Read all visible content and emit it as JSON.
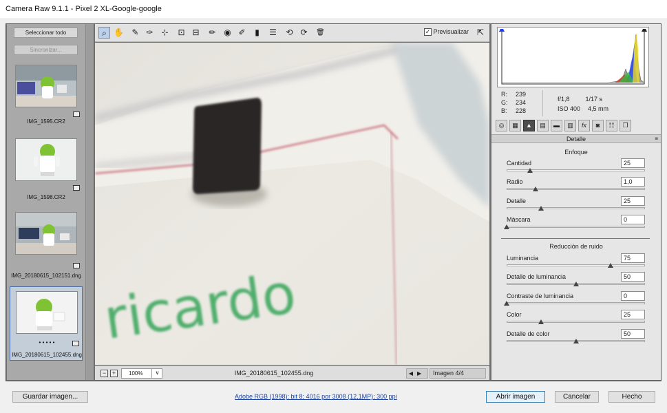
{
  "window": {
    "title": "Camera Raw 9.1.1 -  Pixel 2 XL-Google-google"
  },
  "filmstrip": {
    "select_all": "Seleccionar todo",
    "sync": "Sincronizar...",
    "thumbnails": [
      {
        "name": "IMG_1595.CR2"
      },
      {
        "name": "IMG_1598.CR2"
      },
      {
        "name": "IMG_20180615_102151.dng"
      },
      {
        "name": "IMG_20180615_102455.dng",
        "rating": "• • • • •"
      }
    ]
  },
  "toolbar": {
    "tools": [
      "zoom-icon",
      "hand-icon",
      "white-balance-icon",
      "color-sampler-icon",
      "targeted-adjustment-icon",
      "crop-icon",
      "straighten-icon",
      "spot-removal-icon",
      "red-eye-icon",
      "adjustment-brush-icon",
      "graduated-filter-icon",
      "radial-filter-icon",
      "preferences-icon",
      "rotate-left-icon",
      "rotate-right-icon",
      "trash-icon"
    ],
    "tool_glyphs": [
      "⌕",
      "✋",
      "✎",
      "✑",
      "⊹",
      "⊡",
      "⊟",
      "✏",
      "◉",
      "✐",
      "▮",
      "☰",
      "⟲",
      "⟳",
      "🗑"
    ],
    "preview_label": "Previsualizar",
    "preview_checked": "✓",
    "fullscreen_glyph": "⇱"
  },
  "preview": {
    "text": "ricardo"
  },
  "statusbar": {
    "zoom_minus": "−",
    "zoom_plus": "+",
    "zoom": "100%",
    "zoom_drop": "∨",
    "filename": "IMG_20180615_102455.dng",
    "nav": "◀▶",
    "image_count": "Imagen 4/4"
  },
  "readout": {
    "r_label": "R:",
    "r": "239",
    "g_label": "G:",
    "g": "234",
    "b_label": "B:",
    "b": "228",
    "aperture": "f/1,8",
    "shutter": "1/17 s",
    "iso": "ISO 400",
    "focal": "4,5 mm"
  },
  "panel_tabs": [
    "basic-tab",
    "tone-curve-tab",
    "detail-tab",
    "hsl-tab",
    "split-toning-tab",
    "lens-corrections-tab",
    "effects-tab",
    "camera-calibration-tab",
    "presets-tab",
    "snapshots-tab"
  ],
  "panel_tab_glyphs": [
    "◎",
    "▦",
    "▲",
    "▤",
    "▬",
    "▥",
    "fx",
    "◙",
    "☷",
    "❐"
  ],
  "detail_panel": {
    "title": "Detalle",
    "menu_glyph": "≡",
    "sharpening": {
      "title": "Enfoque",
      "sliders": [
        {
          "label": "Cantidad",
          "value": "25",
          "level": 0.17
        },
        {
          "label": "Radio",
          "value": "1,0",
          "level": 0.21
        },
        {
          "label": "Detalle",
          "value": "25",
          "level": 0.25
        },
        {
          "label": "Máscara",
          "value": "0",
          "level": 0.0
        }
      ]
    },
    "noise": {
      "title": "Reducción de ruido",
      "sliders": [
        {
          "label": "Luminancia",
          "value": "75",
          "level": 0.75
        },
        {
          "label": "Detalle de luminancia",
          "value": "50",
          "level": 0.5
        },
        {
          "label": "Contraste de luminancia",
          "value": "0",
          "level": 0.0
        },
        {
          "label": "Color",
          "value": "25",
          "level": 0.25
        },
        {
          "label": "Detalle de color",
          "value": "50",
          "level": 0.5
        }
      ]
    }
  },
  "footer": {
    "save": "Guardar imagen...",
    "workflow": "Adobe RGB (1998); bit 8; 4016 por 3008 (12,1MP); 300 ppi",
    "open": "Abrir imagen",
    "cancel": "Cancelar",
    "done": "Hecho"
  }
}
